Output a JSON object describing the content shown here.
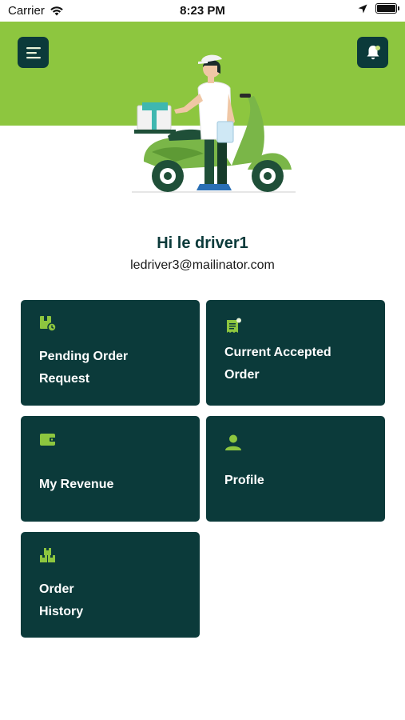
{
  "status_bar": {
    "carrier": "Carrier",
    "time": "8:23 PM"
  },
  "colors": {
    "brand_green": "#8dc63f",
    "dark_teal": "#0b3a3a",
    "icon_green": "#8dc63f"
  },
  "header": {
    "menu_icon": "menu-icon",
    "notification_icon": "bell-icon"
  },
  "greeting": "Hi le driver1",
  "email": "ledriver3@mailinator.com",
  "cards": [
    {
      "label_line1": "Pending Order",
      "label_line2": "Request",
      "icon": "pending-order-icon"
    },
    {
      "label_line1": "Current Accepted",
      "label_line2": "Order",
      "icon": "receipt-icon"
    },
    {
      "label_line1": "My Revenue",
      "label_line2": "",
      "icon": "wallet-icon"
    },
    {
      "label_line1": "Profile",
      "label_line2": "",
      "icon": "user-icon"
    },
    {
      "label_line1": "Order",
      "label_line2": "History",
      "icon": "boxes-icon"
    }
  ]
}
